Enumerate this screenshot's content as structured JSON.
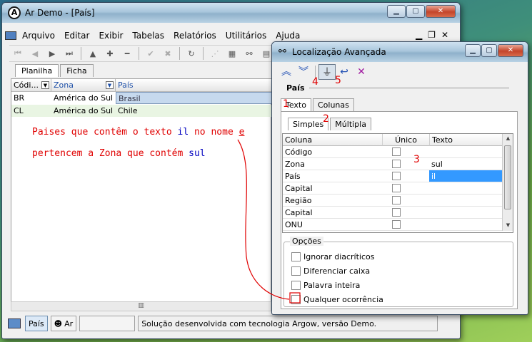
{
  "main_window": {
    "title": "Ar Demo - [País]",
    "menu": [
      "Arquivo",
      "Editar",
      "Exibir",
      "Tabelas",
      "Relatórios",
      "Utilitários",
      "Ajuda"
    ],
    "tabs": [
      "Planilha",
      "Ficha"
    ],
    "columns": [
      "Códi...",
      "Zona",
      "País"
    ],
    "rows": [
      {
        "code": "BR",
        "zona": "América do Sul",
        "pais": "Brasil"
      },
      {
        "code": "CL",
        "zona": "América do Sul",
        "pais": "Chile"
      }
    ],
    "statusbar": {
      "pais_tab": "País",
      "ar_tab": "Ar",
      "message": "Solução desenvolvida com tecnologia Argow, versão Demo."
    }
  },
  "annotation": {
    "line1_a": "Paises que contêm o texto ",
    "line1_b": "il",
    "line1_c": " no nome ",
    "line1_d": "e",
    "line2_a": "pertencem a Zona que contém ",
    "line2_b": "sul",
    "numbers": [
      "1",
      "2",
      "3",
      "4",
      "5"
    ]
  },
  "dialog": {
    "title": "Localização Avançada",
    "field": "País",
    "tabs": [
      "Texto",
      "Colunas"
    ],
    "subtabs": [
      "Simples",
      "Múltipla"
    ],
    "grid_headers": [
      "Coluna",
      "Único",
      "Texto"
    ],
    "grid_rows": [
      {
        "col": "Código",
        "text": ""
      },
      {
        "col": "Zona",
        "text": "sul"
      },
      {
        "col": "País",
        "text": "il",
        "selected": true
      },
      {
        "col": "Capital",
        "text": ""
      },
      {
        "col": "Região",
        "text": ""
      },
      {
        "col": "Capital",
        "text": ""
      },
      {
        "col": "ONU",
        "text": ""
      }
    ],
    "options_label": "Opções",
    "options": [
      "Ignorar diacríticos",
      "Diferenciar caixa",
      "Palavra inteira",
      "Qualquer ocorrência"
    ]
  },
  "colors": {
    "annotation_red": "#e00000",
    "annotation_blue": "#0000c0",
    "selection": "#3399ff"
  }
}
